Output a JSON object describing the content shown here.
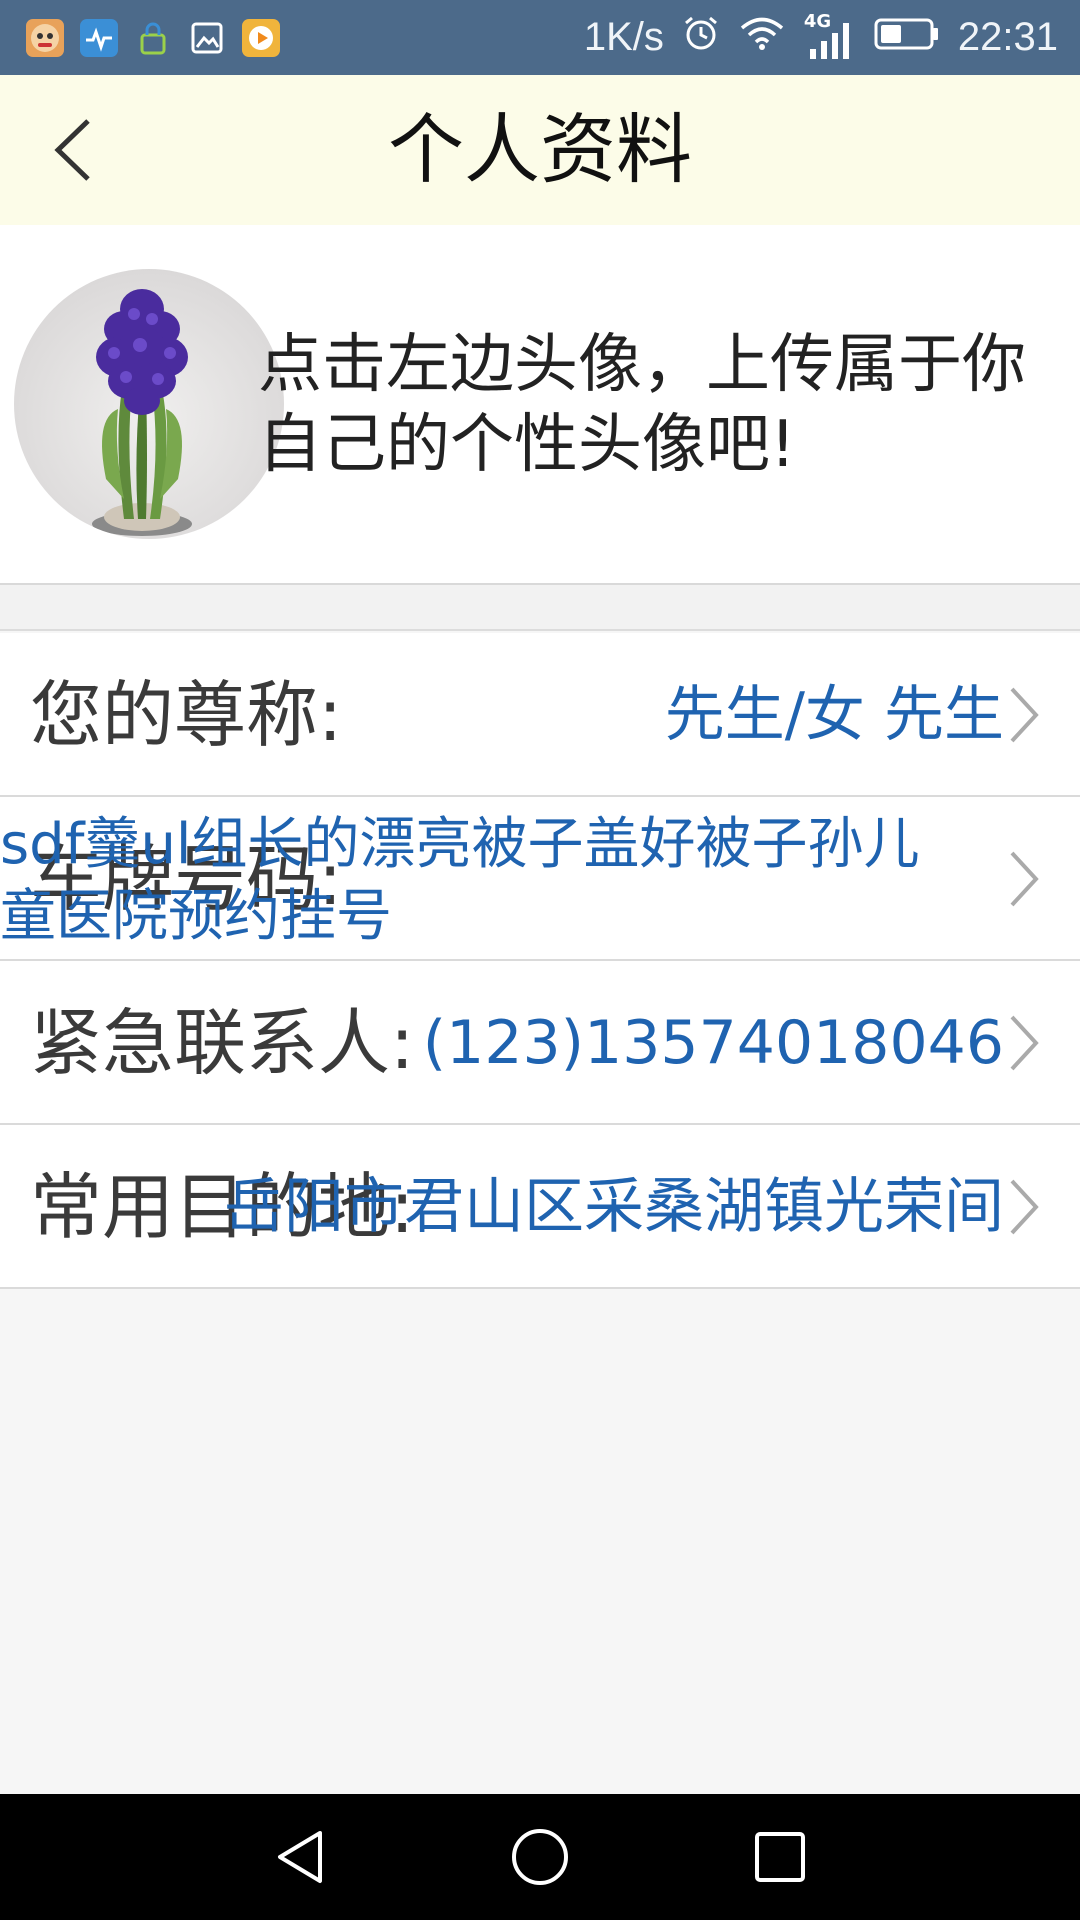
{
  "status_bar": {
    "speed": "1K/s",
    "network": "4G",
    "time": "22:31"
  },
  "header": {
    "title": "个人资料",
    "back_icon": "chevron-left-icon"
  },
  "profile": {
    "hint": "点击左边头像，上传属于你自己的个性头像吧!"
  },
  "rows": [
    {
      "label": "您的尊称:",
      "value": "先生/女 先生"
    },
    {
      "label": "车牌号码:",
      "value": "sdf羹ul组长的漂亮被子盖好被子孙儿童医院预约挂号"
    },
    {
      "label": "紧急联系人:",
      "value": "(123)13574018046"
    },
    {
      "label": "常用目的地:",
      "value": "岳阳市君山区采桑湖镇光荣间"
    }
  ],
  "colors": {
    "status_bar": "#4c6a8a",
    "header_bg": "#fcfce8",
    "value_text": "#1f63b0",
    "label_text": "#3a3a3a"
  }
}
